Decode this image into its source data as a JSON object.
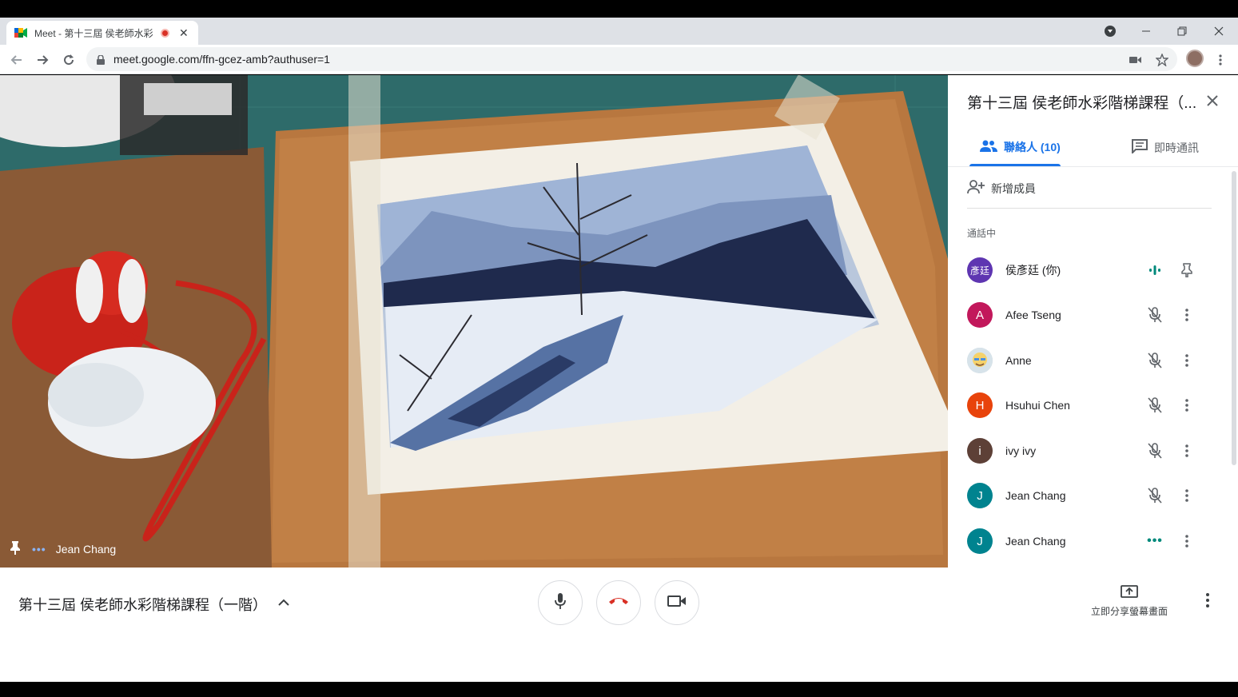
{
  "browser": {
    "tab_title": "Meet - 第十三屆 侯老師水彩",
    "tab_close": "✕",
    "url": "meet.google.com/ffn-gcez-amb?authuser=1"
  },
  "video": {
    "speaker_name": "Jean Chang",
    "speaker_dots": "•••"
  },
  "panel": {
    "title": "第十三屆 侯老師水彩階梯課程（...",
    "tab_people": "聯絡人 (10)",
    "tab_chat": "即時通訊",
    "add_member": "新增成員",
    "section_label": "通話中",
    "participants": [
      {
        "initials": "彥廷",
        "name": "侯彥廷 (你)",
        "color": "#5e35b1",
        "status": "speaking"
      },
      {
        "initials": "A",
        "name": "Afee Tseng",
        "color": "#c2185b",
        "status": "muted"
      },
      {
        "initials": "",
        "name": "Anne",
        "color": "#cfd8dc",
        "status": "muted"
      },
      {
        "initials": "H",
        "name": "Hsuhui Chen",
        "color": "#e8430b",
        "status": "muted"
      },
      {
        "initials": "i",
        "name": "ivy ivy",
        "color": "#5d4037",
        "status": "muted"
      },
      {
        "initials": "J",
        "name": "Jean Chang",
        "color": "#00838f",
        "status": "muted"
      },
      {
        "initials": "J",
        "name": "Jean Chang",
        "color": "#00838f",
        "status": "active",
        "status_text": "•••"
      }
    ]
  },
  "bottom": {
    "meeting_title": "第十三屆 侯老師水彩階梯課程（一階）",
    "present_label": "立即分享螢幕畫面"
  },
  "colors": {
    "accent": "#1a73e8",
    "hangup": "#d93025",
    "speaking": "#00897b"
  }
}
